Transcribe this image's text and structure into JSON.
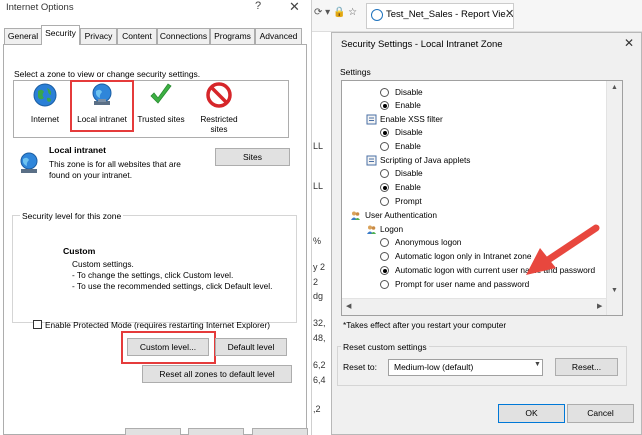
{
  "colors": {
    "highlight": "#e53b3b",
    "arrow": "#e8473e",
    "dialog_bg": "#f0f0f0",
    "button_bg": "#e1e1e1",
    "ok_border": "#0078d7"
  },
  "internet_options": {
    "title": "Internet Options",
    "help": "?",
    "close": "✕",
    "tabs": [
      "General",
      "Security",
      "Privacy",
      "Content",
      "Connections",
      "Programs",
      "Advanced"
    ],
    "zone_prompt": "Select a zone to view or change security settings.",
    "zones": [
      {
        "label": "Internet",
        "icon": "globe-icon"
      },
      {
        "label": "Local intranet",
        "icon": "intranet-globe-icon"
      },
      {
        "label": "Trusted sites",
        "icon": "checkmark-icon"
      },
      {
        "label": "Restricted sites",
        "icon": "no-entry-icon"
      }
    ],
    "selected_zone": "Local intranet",
    "zone_desc_title": "Local intranet",
    "zone_desc": "This zone is for all websites that are found on your intranet.",
    "sites_button": "Sites",
    "security_level_legend": "Security level for this zone",
    "custom_title": "Custom",
    "custom_lines": [
      "Custom settings.",
      "- To change the settings, click Custom level.",
      "- To use the recommended settings, click Default level."
    ],
    "protected_mode_label": "Enable Protected Mode (requires restarting Internet Explorer)",
    "protected_mode_checked": false,
    "custom_level_button": "Custom level...",
    "default_level_button": "Default level",
    "reset_all_button": "Reset all zones to default level"
  },
  "browser": {
    "nav_glyphs": "⟳ ▾ 🔒 ☆",
    "tab_title": "Test_Net_Sales - Report Vie...",
    "tab_close": "✕",
    "background_fragments": [
      "LL",
      "LL",
      "%",
      "y 2",
      "2",
      "dg",
      "32,",
      "48,",
      "6,2",
      "6,4",
      ",2"
    ]
  },
  "security_settings": {
    "title": "Security Settings - Local Intranet Zone",
    "close": "✕",
    "settings_label": "Settings",
    "rows": [
      {
        "type": "radio",
        "label": "Disable",
        "checked": false
      },
      {
        "type": "radio",
        "label": "Enable",
        "checked": true
      },
      {
        "type": "header",
        "label": "Enable XSS filter",
        "icon": "script-icon"
      },
      {
        "type": "radio",
        "label": "Disable",
        "checked": true
      },
      {
        "type": "radio",
        "label": "Enable",
        "checked": false
      },
      {
        "type": "header",
        "label": "Scripting of Java applets",
        "icon": "script-icon"
      },
      {
        "type": "radio",
        "label": "Disable",
        "checked": false
      },
      {
        "type": "radio",
        "label": "Enable",
        "checked": true
      },
      {
        "type": "radio",
        "label": "Prompt",
        "checked": false
      },
      {
        "type": "section",
        "label": "User Authentication",
        "icon": "users-icon"
      },
      {
        "type": "header",
        "label": "Logon",
        "icon": "users-icon"
      },
      {
        "type": "radio",
        "label": "Anonymous logon",
        "checked": false
      },
      {
        "type": "radio",
        "label": "Automatic logon only in Intranet zone",
        "checked": false
      },
      {
        "type": "radio",
        "label": "Automatic logon with current user name and password",
        "checked": true
      },
      {
        "type": "radio",
        "label": "Prompt for user name and password",
        "checked": false
      }
    ],
    "note": "*Takes effect after you restart your computer",
    "reset_legend": "Reset custom settings",
    "reset_to_label": "Reset to:",
    "reset_to_value": "Medium-low (default)",
    "reset_button": "Reset...",
    "ok_button": "OK",
    "cancel_button": "Cancel"
  }
}
